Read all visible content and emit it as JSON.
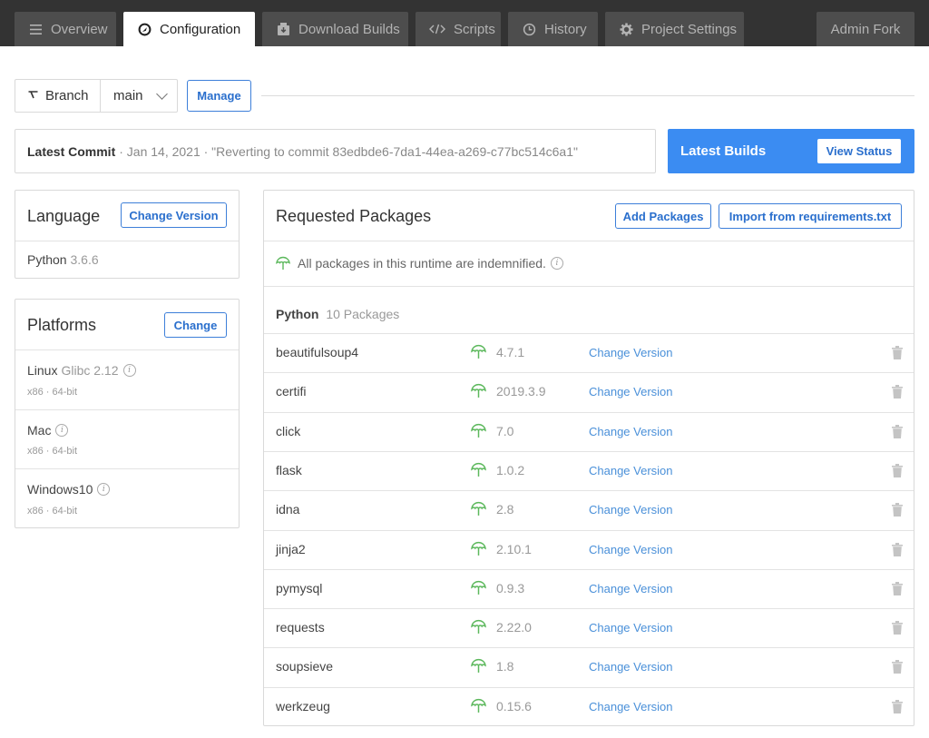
{
  "nav": {
    "tabs": [
      {
        "label": "Overview",
        "icon": "menu-icon"
      },
      {
        "label": "Configuration",
        "icon": "configuration-icon"
      },
      {
        "label": "Download Builds",
        "icon": "download-icon"
      },
      {
        "label": "Scripts",
        "icon": "code-icon"
      },
      {
        "label": "History",
        "icon": "history-icon"
      },
      {
        "label": "Project Settings",
        "icon": "gear-icon"
      }
    ],
    "admin_fork": "Admin Fork"
  },
  "branch": {
    "label": "Branch",
    "selected": "main",
    "manage_button": "Manage"
  },
  "commit": {
    "label": "Latest Commit",
    "meta": "· Jan 14, 2021 · \"Reverting to commit 83edbde6-7da1-44ea-a269-c77bc514c6a1\""
  },
  "builds": {
    "label": "Latest Builds",
    "view_status": "View Status"
  },
  "language": {
    "title": "Language",
    "change_button": "Change Version",
    "name": "Python",
    "version": "3.6.6"
  },
  "platforms": {
    "title": "Platforms",
    "change_button": "Change",
    "items": [
      {
        "name": "Linux",
        "sub": "Glibc 2.12",
        "arch": "x86 · 64-bit"
      },
      {
        "name": "Mac",
        "sub": "",
        "arch": "x86 · 64-bit"
      },
      {
        "name": "Windows10",
        "sub": "",
        "arch": "x86 · 64-bit"
      }
    ]
  },
  "packages": {
    "title": "Requested Packages",
    "add_button": "Add Packages",
    "import_button": "Import from requirements.txt",
    "indemnified_text": "All packages in this runtime are indemnified.",
    "group_label": "Python",
    "group_count": "10 Packages",
    "change_version_label": "Change Version",
    "items": [
      {
        "name": "beautifulsoup4",
        "version": "4.7.1"
      },
      {
        "name": "certifi",
        "version": "2019.3.9"
      },
      {
        "name": "click",
        "version": "7.0"
      },
      {
        "name": "flask",
        "version": "1.0.2"
      },
      {
        "name": "idna",
        "version": "2.8"
      },
      {
        "name": "jinja2",
        "version": "2.10.1"
      },
      {
        "name": "pymysql",
        "version": "0.9.3"
      },
      {
        "name": "requests",
        "version": "2.22.0"
      },
      {
        "name": "soupsieve",
        "version": "1.8"
      },
      {
        "name": "werkzeug",
        "version": "0.15.6"
      }
    ]
  },
  "colors": {
    "topbar": "#333333",
    "tab_inactive": "#4d4d4d",
    "accent_blue": "#3b8cf2",
    "umbrella_green": "#5cb85c"
  }
}
